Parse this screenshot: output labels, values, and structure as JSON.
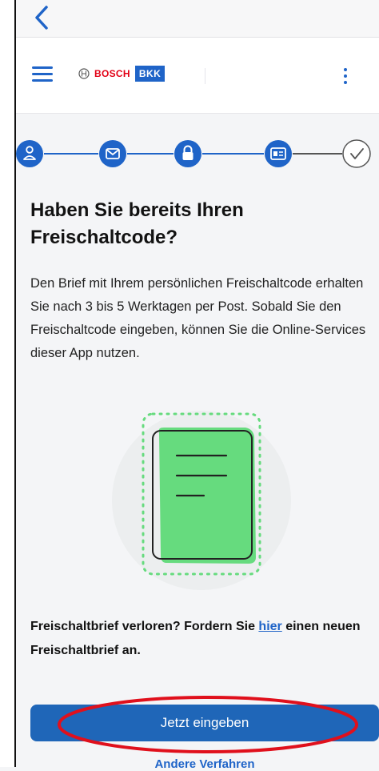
{
  "header": {
    "logo_brand": "BOSCH",
    "logo_bkk": "BKK"
  },
  "stepper": {
    "steps": [
      {
        "icon": "person-icon",
        "state": "done"
      },
      {
        "icon": "envelope-icon",
        "state": "done"
      },
      {
        "icon": "lock-icon",
        "state": "current"
      },
      {
        "icon": "id-card-icon",
        "state": "done"
      },
      {
        "icon": "check-circle-icon",
        "state": "pending"
      }
    ]
  },
  "main": {
    "title": "Haben Sie bereits Ihren Freischaltcode?",
    "description": "Den Brief mit Ihrem persönlichen Freischaltcode erhalten Sie nach 3 bis 5 Werktagen per Post. Sobald Sie den Freischaltcode eingeben, können Sie die Online-Services dieser App nutzen.",
    "lost_prefix": "Freischaltbrief verloren? Fordern Sie ",
    "lost_link": "hier",
    "lost_suffix": " einen neuen Freischaltbrief an.",
    "primary_button": "Jetzt eingeben",
    "secondary_link": "Andere Verfahren"
  },
  "colors": {
    "accent": "#1f64c8",
    "button": "#1f66b8",
    "highlight": "#e0101c",
    "illustration_green": "#66db7e"
  }
}
